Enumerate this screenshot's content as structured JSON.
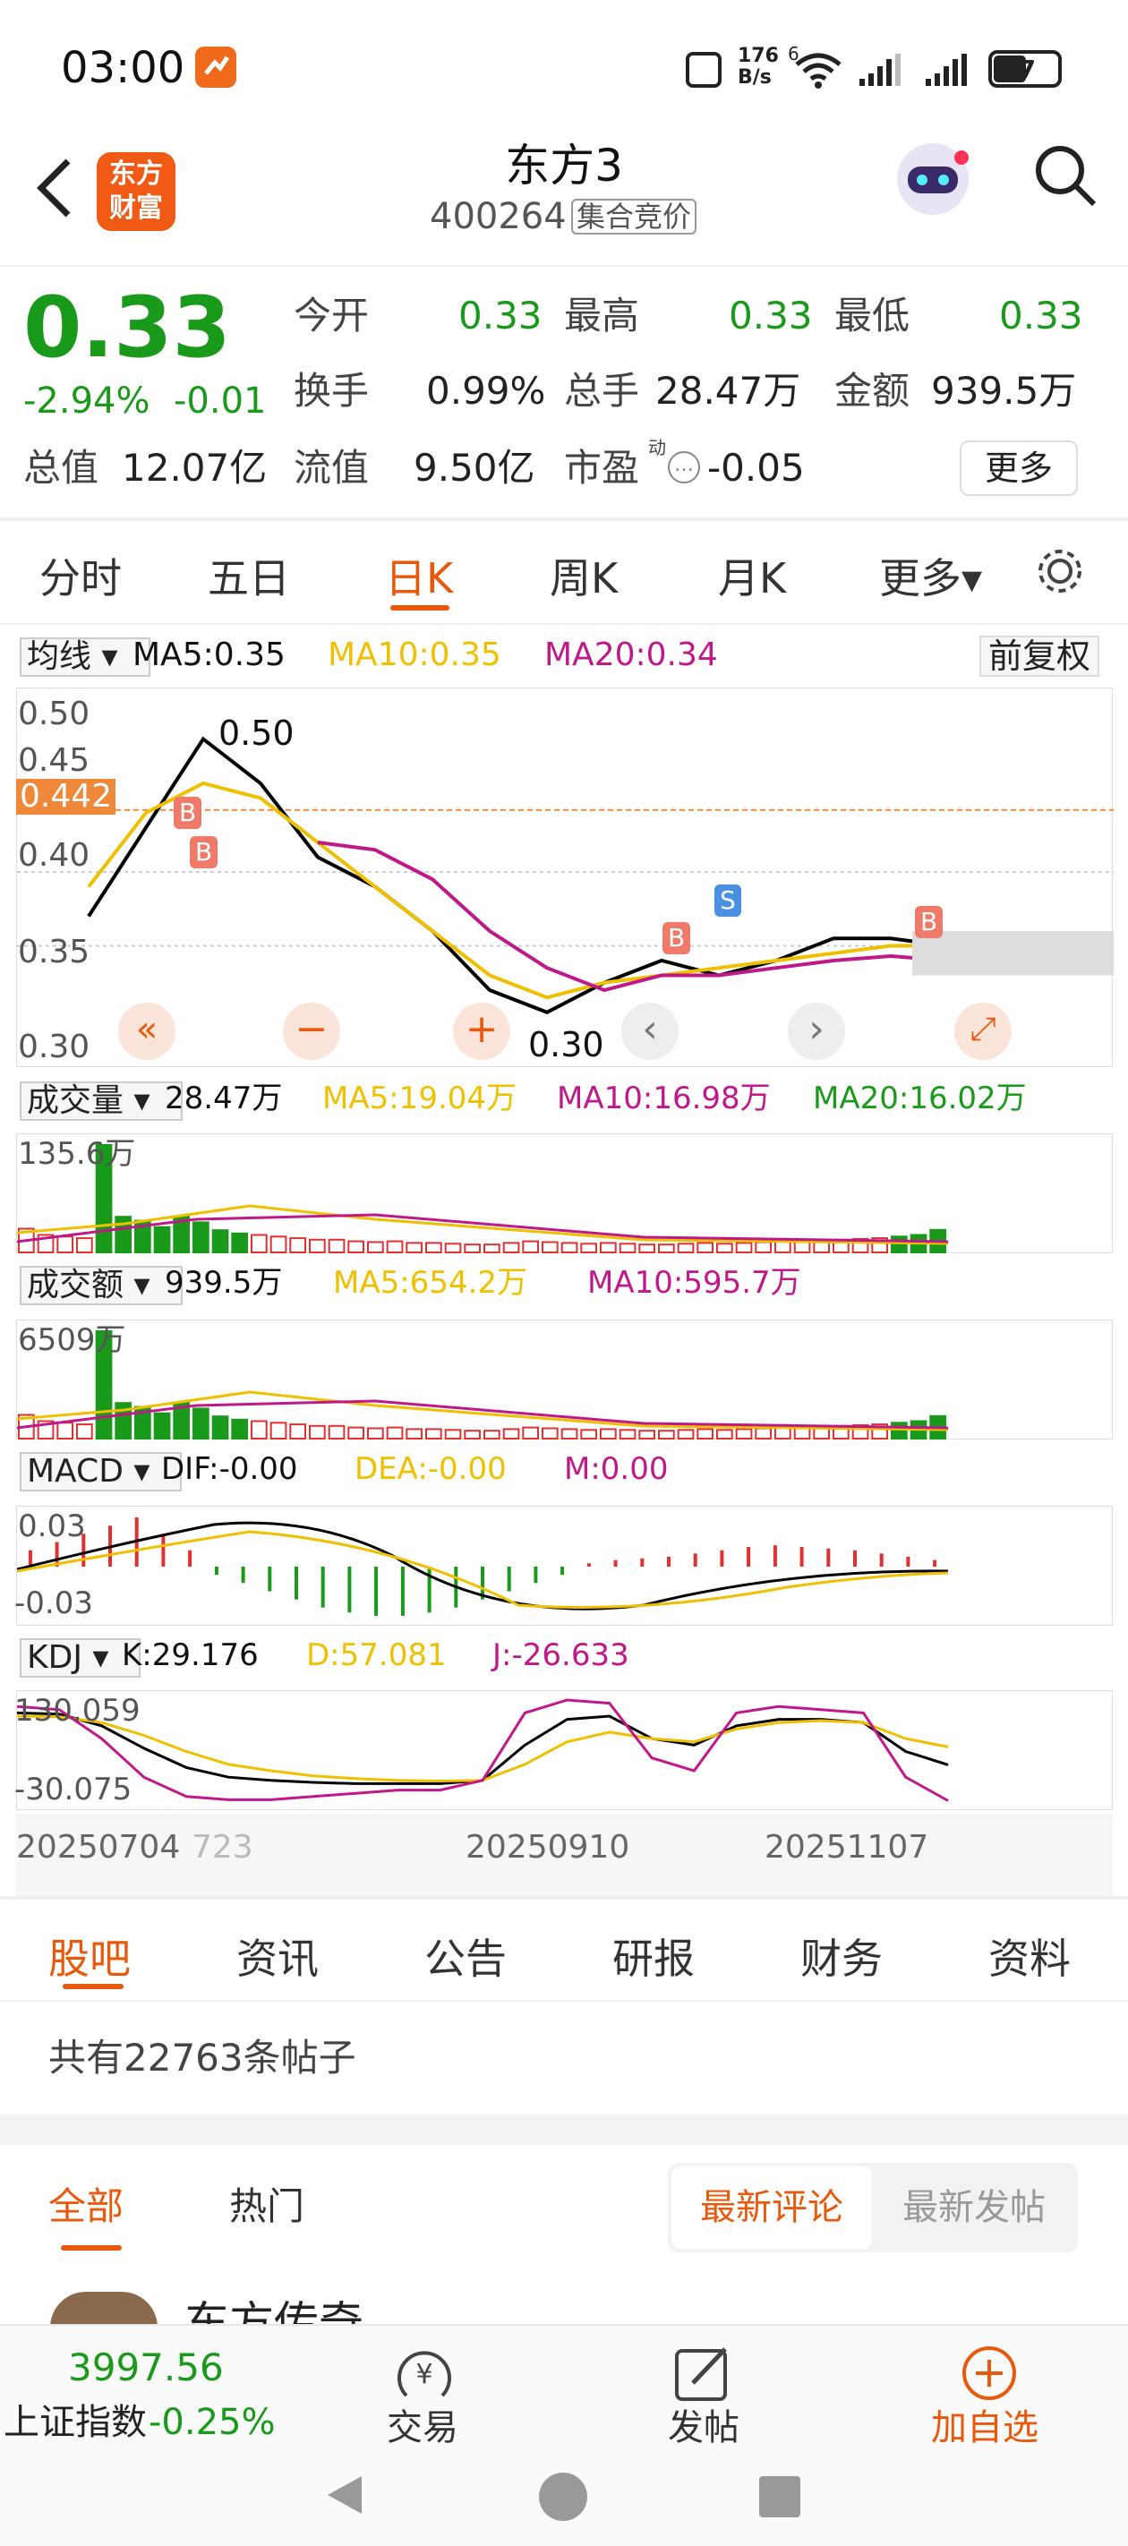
{
  "status_bar": {
    "time": "03:00",
    "speed_top": "176",
    "speed_bottom": "B/s",
    "wifi_sup": "6",
    "battery": "47"
  },
  "header": {
    "logo_line1": "东方",
    "logo_line2": "财富",
    "title": "东方3",
    "code": "400264",
    "badge": "集合竞价"
  },
  "quote": {
    "price": "0.33",
    "change_pct": "-2.94%",
    "change_abs": "-0.01",
    "fields": [
      {
        "label": "今开",
        "value": "0.33",
        "color": "green"
      },
      {
        "label": "最高",
        "value": "0.33",
        "color": "green"
      },
      {
        "label": "最低",
        "value": "0.33",
        "color": "green"
      },
      {
        "label": "换手",
        "value": "0.99%",
        "color": "dark"
      },
      {
        "label": "总手",
        "value": "28.47万",
        "color": "dark"
      },
      {
        "label": "金额",
        "value": "939.5万",
        "color": "dark"
      },
      {
        "label": "总值",
        "value": "12.07亿",
        "color": "dark"
      },
      {
        "label": "流值",
        "value": "9.50亿",
        "color": "dark"
      },
      {
        "label": "市盈",
        "value": "-0.05",
        "color": "dark"
      }
    ],
    "pe_sup": "动",
    "more": "更多"
  },
  "chart_tabs": [
    "分时",
    "五日",
    "日K",
    "周K",
    "月K",
    "更多▾"
  ],
  "ma_bar": {
    "selector": "均线",
    "ma5": "MA5:0.35",
    "ma10": "MA10:0.35",
    "ma20": "MA20:0.34",
    "adjust": "前复权"
  },
  "kline": {
    "ticks": [
      "0.50",
      "0.45",
      "0.40",
      "0.35",
      "0.30"
    ],
    "current": "0.442",
    "high_label": "0.50",
    "low_label": "0.30",
    "marker_b": "B",
    "marker_s": "S"
  },
  "vol_bar": {
    "selector": "成交量",
    "value": "28.47万",
    "ma5": "MA5:19.04万",
    "ma10": "MA10:16.98万",
    "ma20": "MA20:16.02万",
    "max": "135.6万"
  },
  "amt_bar": {
    "selector": "成交额",
    "value": "939.5万",
    "ma5": "MA5:654.2万",
    "ma10": "MA10:595.7万",
    "max": "6509万"
  },
  "macd_bar": {
    "selector": "MACD",
    "dif": "DIF:-0.00",
    "dea": "DEA:-0.00",
    "m": "M:0.00",
    "top": "0.03",
    "bottom": "-0.03"
  },
  "kdj_bar": {
    "selector": "KDJ",
    "k": "K:29.176",
    "d": "D:57.081",
    "j": "J:-26.633",
    "top": "130.059",
    "bottom": "-30.075"
  },
  "dates": {
    "d1": "20250704",
    "d1b": "723",
    "d2": "20250910",
    "d3": "20251107"
  },
  "bottom_tabs": [
    "股吧",
    "资讯",
    "公告",
    "研报",
    "财务",
    "资料"
  ],
  "posts": {
    "count_text": "共有22763条帖子",
    "filter_all": "全部",
    "filter_hot": "热门",
    "sort_latest_comment": "最新评论",
    "sort_latest_post": "最新发帖",
    "partial_name": "东方传奇"
  },
  "footer": {
    "index_value": "3997.56",
    "index_name": "上证指数",
    "index_change": "-0.25%",
    "trade": "交易",
    "post": "发帖",
    "add_watch": "加自选"
  },
  "colors": {
    "up": "#e03030",
    "down": "#1a9a1a",
    "accent": "#e8590c",
    "ma5": "#000000",
    "ma10": "#f0c000",
    "ma20": "#c0188a"
  },
  "chart_data": [
    {
      "type": "line",
      "title": "日K",
      "ylim": [
        0.3,
        0.5
      ],
      "series": [
        {
          "name": "MA5",
          "values": [
            0.37,
            0.43,
            0.49,
            0.46,
            0.41,
            0.39,
            0.36,
            0.32,
            0.305,
            0.325,
            0.34,
            0.33,
            0.34,
            0.355,
            0.355,
            0.35
          ]
        },
        {
          "name": "MA10",
          "values": [
            0.39,
            0.44,
            0.46,
            0.45,
            0.42,
            0.39,
            0.36,
            0.33,
            0.315,
            0.325,
            0.33,
            0.335,
            0.34,
            0.345,
            0.35,
            0.35
          ]
        },
        {
          "name": "MA20",
          "values": [
            null,
            null,
            null,
            null,
            0.42,
            0.415,
            0.395,
            0.36,
            0.335,
            0.32,
            0.33,
            0.33,
            0.335,
            0.34,
            0.343,
            0.34
          ]
        }
      ]
    },
    {
      "type": "bar",
      "title": "成交量",
      "values": [
        30,
        22,
        20,
        18,
        135.6,
        45,
        40,
        32,
        45,
        38,
        28,
        24,
        22,
        20,
        18,
        16,
        16,
        14,
        13,
        14,
        12,
        12,
        11,
        10,
        10,
        12,
        14,
        13,
        12,
        11,
        12,
        11,
        10,
        10,
        11,
        12,
        11,
        12,
        13,
        14,
        15,
        15,
        16,
        17,
        18,
        20,
        22,
        28.47
      ]
    },
    {
      "type": "bar",
      "title": "MACD",
      "values": [
        0.01,
        0.015,
        0.02,
        0.025,
        0.03,
        0.02,
        0.01,
        -0.005,
        -0.01,
        -0.015,
        -0.02,
        -0.025,
        -0.028,
        -0.03,
        -0.03,
        -0.028,
        -0.025,
        -0.02,
        -0.015,
        -0.01,
        -0.005,
        0.002,
        0.004,
        0.005,
        0.006,
        0.008,
        0.01,
        0.012,
        0.013,
        0.012,
        0.011,
        0.01,
        0.008,
        0.006,
        0.004
      ]
    },
    {
      "type": "line",
      "title": "KDJ",
      "ylim": [
        -30.075,
        130.059
      ],
      "series": [
        {
          "name": "K",
          "values": [
            110,
            108,
            90,
            55,
            25,
            10,
            5,
            2,
            0,
            0,
            0,
            5,
            60,
            100,
            105,
            70,
            60,
            90,
            100,
            100,
            95,
            50,
            29.176
          ]
        },
        {
          "name": "D",
          "values": [
            105,
            104,
            95,
            75,
            50,
            30,
            20,
            12,
            8,
            5,
            4,
            5,
            30,
            65,
            80,
            70,
            65,
            85,
            95,
            98,
            95,
            70,
            57.081
          ]
        },
        {
          "name": "J",
          "values": [
            120,
            115,
            70,
            10,
            -20,
            -25,
            -25,
            -20,
            -15,
            -10,
            -10,
            5,
            110,
            130,
            125,
            40,
            20,
            110,
            120,
            115,
            110,
            10,
            -26.633
          ]
        }
      ]
    }
  ]
}
